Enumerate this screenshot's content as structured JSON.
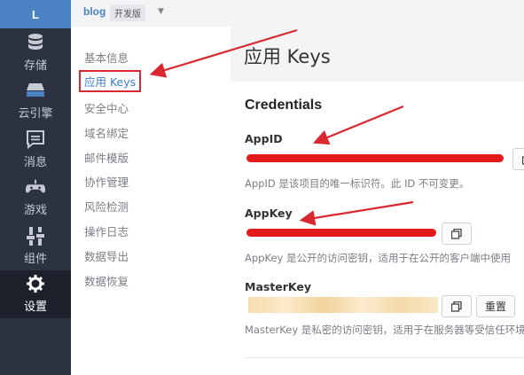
{
  "rail": {
    "logo": "L",
    "items": [
      {
        "label": "存储",
        "icon": "database-icon"
      },
      {
        "label": "云引擎",
        "icon": "cloud-engine-icon"
      },
      {
        "label": "消息",
        "icon": "message-icon"
      },
      {
        "label": "游戏",
        "icon": "gamepad-icon"
      },
      {
        "label": "组件",
        "icon": "components-icon"
      },
      {
        "label": "设置",
        "icon": "gear-icon",
        "active": true
      }
    ]
  },
  "topbar": {
    "app_name": "blog",
    "env": "开发版"
  },
  "subnav": {
    "items": [
      {
        "label": "基本信息"
      },
      {
        "label": "应用 Keys",
        "active": true
      },
      {
        "label": "安全中心"
      },
      {
        "label": "域名绑定"
      },
      {
        "label": "邮件模版"
      },
      {
        "label": "协作管理"
      },
      {
        "label": "风险检测"
      },
      {
        "label": "操作日志"
      },
      {
        "label": "数据导出"
      },
      {
        "label": "数据恢复"
      }
    ]
  },
  "page": {
    "title": "应用 Keys"
  },
  "credentials": {
    "title": "Credentials",
    "appid": {
      "label": "AppID",
      "desc": "AppID 是该项目的唯一标识符。此 ID 不可变更。"
    },
    "appkey": {
      "label": "AppKey",
      "desc": "AppKey 是公开的访问密钥，适用于在公开的客户端中使用"
    },
    "masterkey": {
      "label": "MasterKey",
      "desc": "MasterKey 是私密的访问密钥，适用于在服务器等受信任环境",
      "reset": "重置"
    }
  },
  "colors": {
    "accent": "#4a82c4",
    "rail_bg": "#2c3240",
    "annotation_red": "#d9282f"
  }
}
